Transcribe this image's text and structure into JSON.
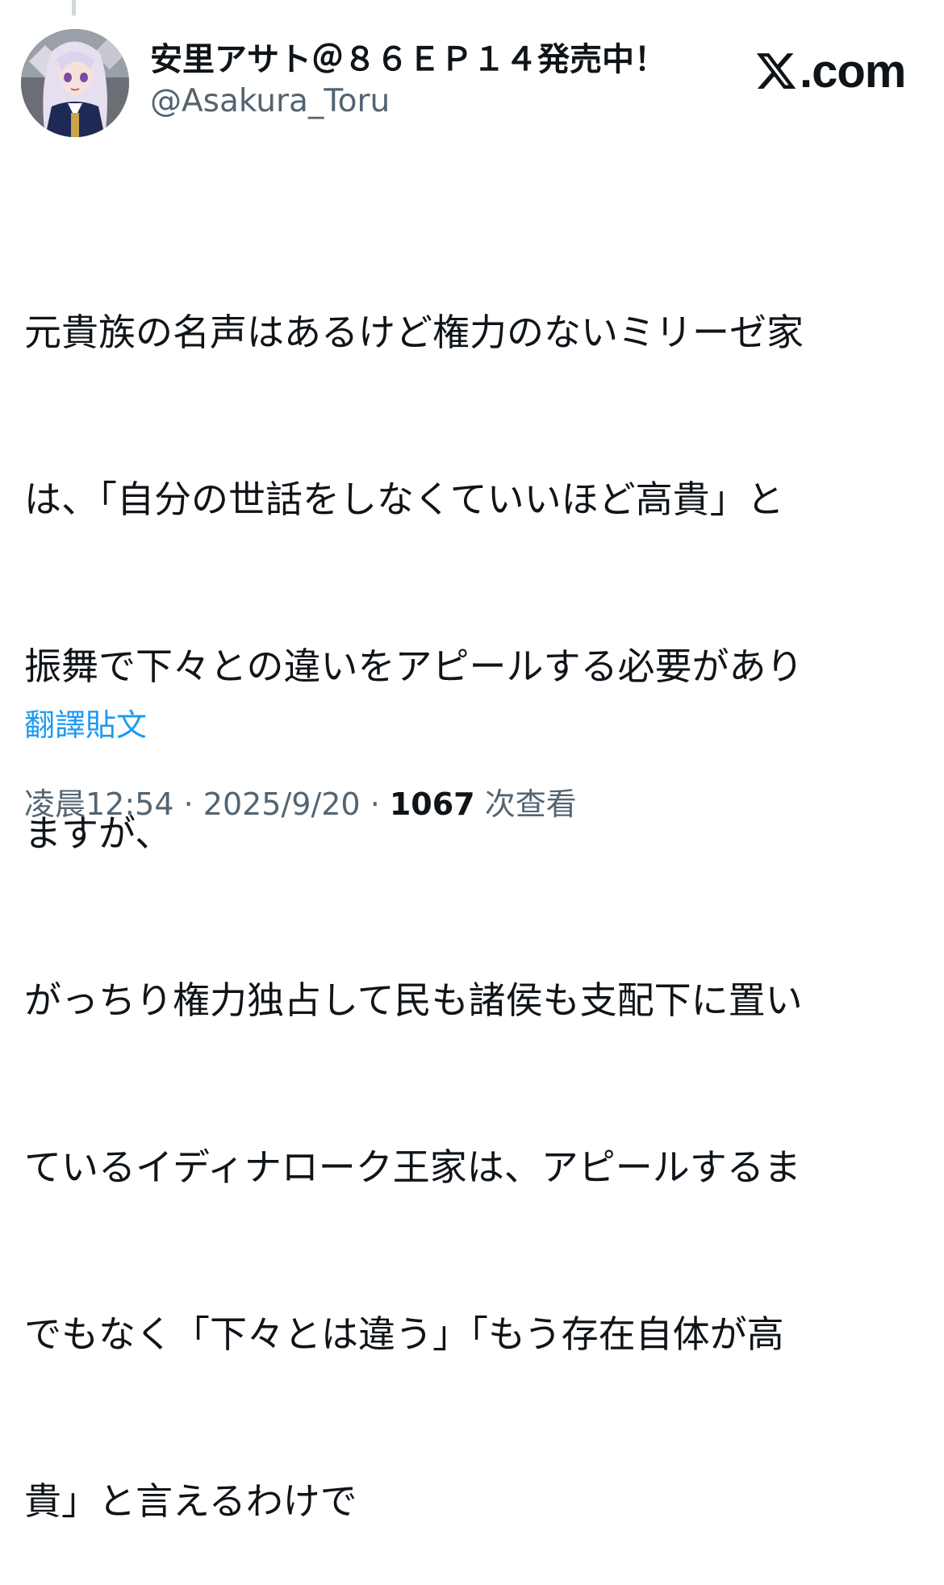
{
  "author": {
    "display_name": "安里アサト＠８６ＥＰ１４発売中！",
    "handle": "@Asakura_Toru",
    "avatar_icon": "anime-character-avatar"
  },
  "brand": {
    "icon": "x-logo-icon",
    "label": ".com"
  },
  "tweet": {
    "lines": [
      "元貴族の名声はあるけど権力のないミリーゼ家",
      "は、「自分の世話をしなくていいほど高貴」と",
      "振舞で下々との違いをアピールする必要があり",
      "ますが、",
      "がっちり権力独占して民も諸侯も支配下に置い",
      "ているイディナローク王家は、アピールするま",
      "でもなく「下々とは違う」「もう存在自体が高",
      "貴」と言えるわけで"
    ],
    "translate_label": "翻譯貼文"
  },
  "meta": {
    "time": "凌晨12:54",
    "separator": " · ",
    "date": "2025/9/20",
    "views_count": "1067",
    "views_label": "次查看"
  },
  "colors": {
    "text": "#0f1419",
    "secondary": "#536471",
    "link": "#1d9bf0"
  }
}
